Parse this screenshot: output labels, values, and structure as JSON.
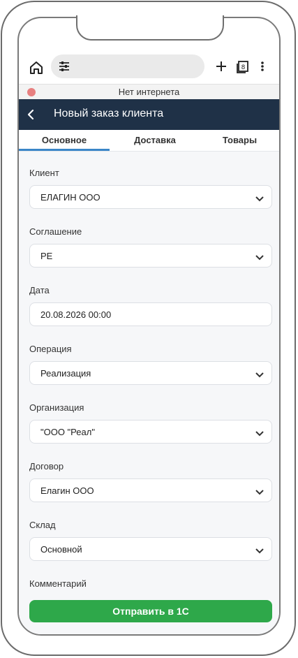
{
  "offline_text": "Нет интернета",
  "appbar": {
    "title": "Новый заказ клиента"
  },
  "tabs": [
    "Основное",
    "Доставка",
    "Товары"
  ],
  "fields": [
    {
      "label": "Клиент",
      "value": "ЕЛАГИН ООО",
      "dropdown": true
    },
    {
      "label": "Соглашение",
      "value": "РЕ",
      "dropdown": true
    },
    {
      "label": "Дата",
      "value": "20.08.2026 00:00",
      "dropdown": false
    },
    {
      "label": "Операция",
      "value": "Реализация",
      "dropdown": true
    },
    {
      "label": "Организация",
      "value": "\"ООО \"Реал\"",
      "dropdown": true
    },
    {
      "label": "Договор",
      "value": "Елагин ООО",
      "dropdown": true
    },
    {
      "label": "Склад",
      "value": "Основной",
      "dropdown": true
    },
    {
      "label": "Комментарий",
      "value": "",
      "dropdown": false
    }
  ],
  "submit_label": "Отправить в 1С",
  "colors": {
    "appbar": "#1f3147",
    "accent": "#3a86c8",
    "submit": "#2ea84a",
    "offline_dot": "#e88080"
  }
}
